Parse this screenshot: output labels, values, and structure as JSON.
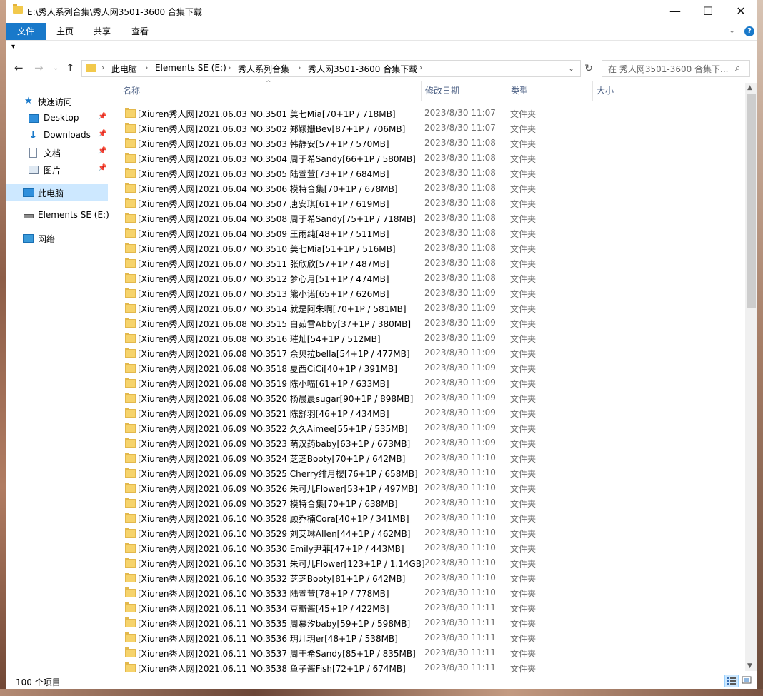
{
  "window": {
    "title": "E:\\秀人系列合集\\秀人网3501-3600 合集下载",
    "minimize_glyph": "—",
    "maximize_glyph": "☐",
    "close_glyph": "✕"
  },
  "ribbon": {
    "tabs": [
      {
        "label": "文件",
        "active": true
      },
      {
        "label": "主页",
        "active": false
      },
      {
        "label": "共享",
        "active": false
      },
      {
        "label": "查看",
        "active": false
      }
    ],
    "help_glyph": "?"
  },
  "address": {
    "breadcrumbs": [
      "此电脑",
      "Elements SE (E:)",
      "秀人系列合集",
      "秀人网3501-3600 合集下载"
    ],
    "search_placeholder": "在 秀人网3501-3600 合集下..."
  },
  "nav_pane": {
    "items": [
      {
        "label": "快速访问",
        "icon": "star-icon",
        "pinned": false
      },
      {
        "label": "Desktop",
        "icon": "desktop-icon",
        "pinned": true
      },
      {
        "label": "Downloads",
        "icon": "download-icon",
        "pinned": true
      },
      {
        "label": "文档",
        "icon": "documents-icon",
        "pinned": true
      },
      {
        "label": "图片",
        "icon": "pictures-icon",
        "pinned": true
      },
      {
        "label": "此电脑",
        "icon": "computer-icon",
        "pinned": false,
        "selected": true
      },
      {
        "label": "Elements SE (E:)",
        "icon": "drive-icon",
        "pinned": false
      },
      {
        "label": "网络",
        "icon": "network-icon",
        "pinned": false
      }
    ]
  },
  "columns": {
    "name": "名称",
    "date": "修改日期",
    "type": "类型",
    "size": "大小"
  },
  "files": [
    {
      "name": "[Xiuren秀人网]2021.06.03 NO.3501 美七Mia[70+1P / 718MB]",
      "date": "2023/8/30 11:07",
      "type": "文件夹"
    },
    {
      "name": "[Xiuren秀人网]2021.06.03 NO.3502 郑颖姗Bev[87+1P / 706MB]",
      "date": "2023/8/30 11:07",
      "type": "文件夹"
    },
    {
      "name": "[Xiuren秀人网]2021.06.03 NO.3503 韩静安[57+1P / 570MB]",
      "date": "2023/8/30 11:08",
      "type": "文件夹"
    },
    {
      "name": "[Xiuren秀人网]2021.06.03 NO.3504 周于希Sandy[66+1P / 580MB]",
      "date": "2023/8/30 11:08",
      "type": "文件夹"
    },
    {
      "name": "[Xiuren秀人网]2021.06.03 NO.3505 陆萱萱[73+1P / 684MB]",
      "date": "2023/8/30 11:08",
      "type": "文件夹"
    },
    {
      "name": "[Xiuren秀人网]2021.06.04 NO.3506 模特合集[70+1P / 678MB]",
      "date": "2023/8/30 11:08",
      "type": "文件夹"
    },
    {
      "name": "[Xiuren秀人网]2021.06.04 NO.3507 唐安琪[61+1P / 619MB]",
      "date": "2023/8/30 11:08",
      "type": "文件夹"
    },
    {
      "name": "[Xiuren秀人网]2021.06.04 NO.3508 周于希Sandy[75+1P / 718MB]",
      "date": "2023/8/30 11:08",
      "type": "文件夹"
    },
    {
      "name": "[Xiuren秀人网]2021.06.04 NO.3509 王雨纯[48+1P / 511MB]",
      "date": "2023/8/30 11:08",
      "type": "文件夹"
    },
    {
      "name": "[Xiuren秀人网]2021.06.07 NO.3510 美七Mia[51+1P / 516MB]",
      "date": "2023/8/30 11:08",
      "type": "文件夹"
    },
    {
      "name": "[Xiuren秀人网]2021.06.07 NO.3511 张欣欣[57+1P / 487MB]",
      "date": "2023/8/30 11:08",
      "type": "文件夹"
    },
    {
      "name": "[Xiuren秀人网]2021.06.07 NO.3512 梦心月[51+1P / 474MB]",
      "date": "2023/8/30 11:08",
      "type": "文件夹"
    },
    {
      "name": "[Xiuren秀人网]2021.06.07 NO.3513 熊小诺[65+1P / 626MB]",
      "date": "2023/8/30 11:09",
      "type": "文件夹"
    },
    {
      "name": "[Xiuren秀人网]2021.06.07 NO.3514 就是阿朱啊[70+1P / 581MB]",
      "date": "2023/8/30 11:09",
      "type": "文件夹"
    },
    {
      "name": "[Xiuren秀人网]2021.06.08 NO.3515 白茹雪Abby[37+1P / 380MB]",
      "date": "2023/8/30 11:09",
      "type": "文件夹"
    },
    {
      "name": "[Xiuren秀人网]2021.06.08 NO.3516 璀灿[54+1P / 512MB]",
      "date": "2023/8/30 11:09",
      "type": "文件夹"
    },
    {
      "name": "[Xiuren秀人网]2021.06.08 NO.3517 佘贝拉bella[54+1P / 477MB]",
      "date": "2023/8/30 11:09",
      "type": "文件夹"
    },
    {
      "name": "[Xiuren秀人网]2021.06.08 NO.3518 夏西CiCi[40+1P / 391MB]",
      "date": "2023/8/30 11:09",
      "type": "文件夹"
    },
    {
      "name": "[Xiuren秀人网]2021.06.08 NO.3519 陈小喵[61+1P / 633MB]",
      "date": "2023/8/30 11:09",
      "type": "文件夹"
    },
    {
      "name": "[Xiuren秀人网]2021.06.08 NO.3520 杨晨晨sugar[90+1P / 898MB]",
      "date": "2023/8/30 11:09",
      "type": "文件夹"
    },
    {
      "name": "[Xiuren秀人网]2021.06.09 NO.3521 陈舒羽[46+1P / 434MB]",
      "date": "2023/8/30 11:09",
      "type": "文件夹"
    },
    {
      "name": "[Xiuren秀人网]2021.06.09 NO.3522 久久Aimee[55+1P / 535MB]",
      "date": "2023/8/30 11:09",
      "type": "文件夹"
    },
    {
      "name": "[Xiuren秀人网]2021.06.09 NO.3523 萌汉药baby[63+1P / 673MB]",
      "date": "2023/8/30 11:09",
      "type": "文件夹"
    },
    {
      "name": "[Xiuren秀人网]2021.06.09 NO.3524 芝芝Booty[70+1P / 642MB]",
      "date": "2023/8/30 11:10",
      "type": "文件夹"
    },
    {
      "name": "[Xiuren秀人网]2021.06.09 NO.3525 Cherry绯月樱[76+1P / 658MB]",
      "date": "2023/8/30 11:10",
      "type": "文件夹"
    },
    {
      "name": "[Xiuren秀人网]2021.06.09 NO.3526 朱可儿Flower[53+1P / 497MB]",
      "date": "2023/8/30 11:10",
      "type": "文件夹"
    },
    {
      "name": "[Xiuren秀人网]2021.06.09 NO.3527 模特合集[70+1P / 638MB]",
      "date": "2023/8/30 11:10",
      "type": "文件夹"
    },
    {
      "name": "[Xiuren秀人网]2021.06.10 NO.3528 顾乔楠Cora[40+1P / 341MB]",
      "date": "2023/8/30 11:10",
      "type": "文件夹"
    },
    {
      "name": "[Xiuren秀人网]2021.06.10 NO.3529 刘艾琳Allen[44+1P / 462MB]",
      "date": "2023/8/30 11:10",
      "type": "文件夹"
    },
    {
      "name": "[Xiuren秀人网]2021.06.10 NO.3530 Emily尹菲[47+1P / 443MB]",
      "date": "2023/8/30 11:10",
      "type": "文件夹"
    },
    {
      "name": "[Xiuren秀人网]2021.06.10 NO.3531 朱可儿Flower[123+1P / 1.14GB]",
      "date": "2023/8/30 11:10",
      "type": "文件夹"
    },
    {
      "name": "[Xiuren秀人网]2021.06.10 NO.3532 芝芝Booty[81+1P / 642MB]",
      "date": "2023/8/30 11:10",
      "type": "文件夹"
    },
    {
      "name": "[Xiuren秀人网]2021.06.10 NO.3533 陆萱萱[78+1P / 778MB]",
      "date": "2023/8/30 11:10",
      "type": "文件夹"
    },
    {
      "name": "[Xiuren秀人网]2021.06.11 NO.3534 豆瓣酱[45+1P / 422MB]",
      "date": "2023/8/30 11:11",
      "type": "文件夹"
    },
    {
      "name": "[Xiuren秀人网]2021.06.11 NO.3535 周慕汐baby[59+1P / 598MB]",
      "date": "2023/8/30 11:11",
      "type": "文件夹"
    },
    {
      "name": "[Xiuren秀人网]2021.06.11 NO.3536 玥儿玥er[48+1P / 538MB]",
      "date": "2023/8/30 11:11",
      "type": "文件夹"
    },
    {
      "name": "[Xiuren秀人网]2021.06.11 NO.3537 周于希Sandy[85+1P / 835MB]",
      "date": "2023/8/30 11:11",
      "type": "文件夹"
    },
    {
      "name": "[Xiuren秀人网]2021.06.11 NO.3538 鱼子酱Fish[72+1P / 674MB]",
      "date": "2023/8/30 11:11",
      "type": "文件夹"
    }
  ],
  "status": {
    "item_count": "100 个项目"
  },
  "colors": {
    "accent": "#1979ca",
    "selection": "#cde8ff",
    "folder": "#f6d36b",
    "header_text": "#4d6185"
  }
}
